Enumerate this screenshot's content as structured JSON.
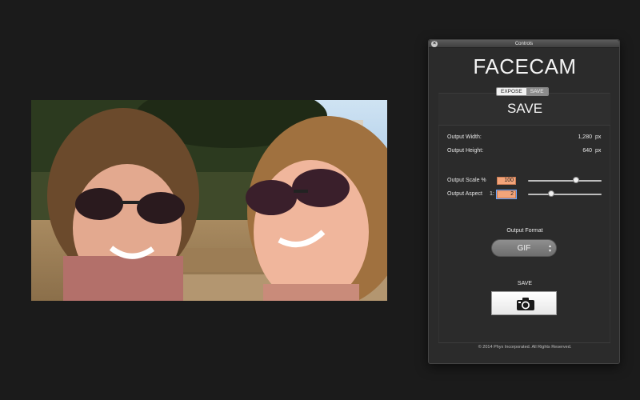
{
  "window": {
    "title": "Controls"
  },
  "app": {
    "title": "FACECAM"
  },
  "modes": {
    "expose_label": "EXPOSE",
    "save_label": "SAVE",
    "active": "EXPOSE"
  },
  "section": {
    "title": "SAVE"
  },
  "output": {
    "width_label": "Output Width:",
    "width_value": "1,280",
    "width_unit": "px",
    "height_label": "Output Height:",
    "height_value": "640",
    "height_unit": "px",
    "scale_label": "Output Scale %",
    "scale_value": "100",
    "scale_slider_fraction": 0.65,
    "aspect_label": "Output Aspect",
    "aspect_prefix": "1:",
    "aspect_value": "2",
    "aspect_slider_fraction": 0.32,
    "format_label": "Output Format",
    "format_value": "GIF"
  },
  "save": {
    "label": "SAVE",
    "icon": "camera-icon"
  },
  "footer": {
    "copyright": "© 2014 Phyx Incorporated.   All Rights Reserved."
  },
  "colors": {
    "field_highlight": "#f3a47a",
    "panel_bg": "#2b2b2b",
    "desktop_bg": "#1b1b1b"
  }
}
